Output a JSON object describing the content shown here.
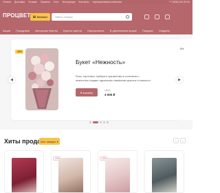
{
  "topnav": {
    "links": [
      "Оплата",
      "Доставка",
      "Отзывы",
      "Правила",
      "Блог",
      "Инструкция",
      "Контакты",
      "Корпоративным клиентам"
    ],
    "phone": "+7 (928) 222-00-00"
  },
  "header": {
    "logo": "ПРОЦВЕТЫ",
    "catalog_label": "Каталог",
    "search_placeholder": "Найти товары"
  },
  "menu": {
    "items": [
      "Акции",
      "Праздники",
      "Авторские букеты",
      "Букеты цветов",
      "Оформление",
      "В деревянном ящике",
      "Подарки",
      "Свадьба"
    ]
  },
  "slide": {
    "badge": "-10%",
    "title": "Букет «Нежность»",
    "description": "Розы, гортензии, гербера и хризантемы в сочетании с нежностью создают идеальную симфонию красоты и нежности",
    "cart_label": "В корзину",
    "price_label": "Цена",
    "price": "3 000 ₽",
    "peek_badge": "-5%"
  },
  "bestsellers": {
    "title": "Хиты продаж",
    "select_label": "Все товары",
    "cards": [
      {
        "tag": "",
        "color": "#9b2f46"
      },
      {
        "tag": "-10%",
        "color": "#d8c3b7"
      },
      {
        "tag": "-10%",
        "color": "#e9d4d2"
      },
      {
        "tag": "",
        "color": "#5e6a6f"
      }
    ]
  }
}
